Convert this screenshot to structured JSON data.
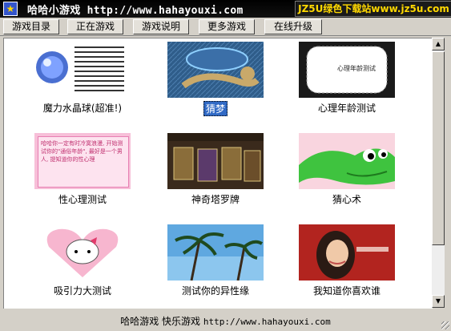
{
  "window": {
    "title": "哈哈小游戏 http://www.hahayouxi.com",
    "banner": "JZ5U绿色下载站www.jz5u.com"
  },
  "tabs": [
    {
      "label": "游戏目录"
    },
    {
      "label": "正在游戏"
    },
    {
      "label": "游戏说明"
    },
    {
      "label": "更多游戏"
    },
    {
      "label": "在线升级"
    }
  ],
  "games": [
    {
      "label": "魔力水晶球(超准!)",
      "icon": "crystal-ball-thumb"
    },
    {
      "label": "猜梦",
      "icon": "catdog-thumb",
      "selected": true
    },
    {
      "label": "心理年龄测试",
      "icon": "psych-age-thumb"
    },
    {
      "label": "性心理测试",
      "icon": "pink-card-thumb"
    },
    {
      "label": "神奇塔罗牌",
      "icon": "tarot-thumb"
    },
    {
      "label": "猜心术",
      "icon": "green-creature-thumb"
    },
    {
      "label": "吸引力大测试",
      "icon": "hello-kitty-thumb"
    },
    {
      "label": "测试你的异性缘",
      "icon": "palm-trees-thumb"
    },
    {
      "label": "我知道你喜欢谁",
      "icon": "portrait-thumb"
    }
  ],
  "thumb_text": {
    "psych_age": "心理年龄测试",
    "pink_card": "哈哈你一定有时冷寞浪漫, 开始测试你的\"通俗年龄\", 最好是一个男人, 提知道你的性心理"
  },
  "footer": {
    "text": "哈哈游戏 快乐游戏",
    "url": "http://www.hahayouxi.com"
  },
  "colors": {
    "titlebar": "#000000",
    "banner_text": "#ffd800",
    "selection": "#316ac5",
    "window_bg": "#d4d0c8"
  }
}
